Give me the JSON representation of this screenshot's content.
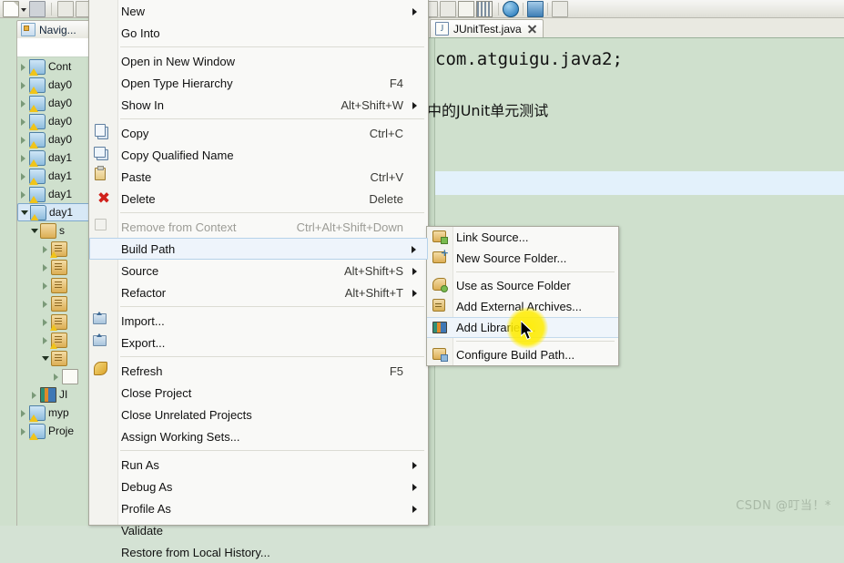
{
  "toolbar": {
    "icons": [
      "new-document-icon",
      "new-dropdown-arrow",
      "save-icon",
      "print-icon",
      "open-resource-icon",
      "search-icon",
      "new-folder-icon",
      "open-folder-icon",
      "pencil-edit-icon",
      "edit-dropdown-arrow",
      "run-icon",
      "debug-icon",
      "coverage-icon",
      "external-tools-icon",
      "table-view-icon",
      "bars-view-icon",
      "globe-browser-icon",
      "perspective-switch-icon",
      "annotation-icon"
    ]
  },
  "left_pane": {
    "tab_label": "Navig...",
    "tab_icon": "navigator-icon",
    "tree": [
      {
        "label": "Cont",
        "expanded": false,
        "icon": "project-warning-icon",
        "indent": 0,
        "selected": false
      },
      {
        "label": "day0",
        "expanded": false,
        "icon": "project-warning-icon",
        "indent": 0,
        "selected": false
      },
      {
        "label": "day0",
        "expanded": false,
        "icon": "project-warning-icon",
        "indent": 0,
        "selected": false
      },
      {
        "label": "day0",
        "expanded": false,
        "icon": "project-icon",
        "indent": 0,
        "selected": false
      },
      {
        "label": "day0",
        "expanded": false,
        "icon": "project-icon",
        "indent": 0,
        "selected": false
      },
      {
        "label": "day1",
        "expanded": false,
        "icon": "project-warning-icon",
        "indent": 0,
        "selected": false
      },
      {
        "label": "day1",
        "expanded": false,
        "icon": "project-warning-icon",
        "indent": 0,
        "selected": false
      },
      {
        "label": "day1",
        "expanded": false,
        "icon": "project-warning-icon",
        "indent": 0,
        "selected": false
      },
      {
        "label": "day1",
        "expanded": true,
        "icon": "project-warning-icon",
        "indent": 0,
        "selected": true
      },
      {
        "label": "s",
        "expanded": true,
        "icon": "source-folder-icon",
        "indent": 1,
        "selected": false
      },
      {
        "label": "",
        "expanded": false,
        "icon": "package-warning-icon",
        "indent": 2,
        "selected": false
      },
      {
        "label": "",
        "expanded": false,
        "icon": "package-icon",
        "indent": 2,
        "selected": false
      },
      {
        "label": "",
        "expanded": false,
        "icon": "package-icon",
        "indent": 2,
        "selected": false
      },
      {
        "label": "",
        "expanded": false,
        "icon": "package-icon",
        "indent": 2,
        "selected": false
      },
      {
        "label": "",
        "expanded": false,
        "icon": "package-warning-icon",
        "indent": 2,
        "selected": false
      },
      {
        "label": "",
        "expanded": false,
        "icon": "package-warning-icon",
        "indent": 2,
        "selected": false
      },
      {
        "label": "",
        "expanded": true,
        "icon": "package-icon",
        "indent": 2,
        "selected": false
      },
      {
        "label": "",
        "expanded": false,
        "icon": "file-icon",
        "indent": 3,
        "selected": false
      },
      {
        "label": "JI",
        "expanded": false,
        "icon": "jre-library-icon",
        "indent": 1,
        "selected": false
      },
      {
        "label": "myp",
        "expanded": false,
        "icon": "project-icon",
        "indent": 0,
        "selected": false
      },
      {
        "label": "Proje",
        "expanded": false,
        "icon": "project-warning-icon",
        "indent": 0,
        "selected": false
      }
    ]
  },
  "editor": {
    "tab_label": "JUnitTest.java",
    "tab_icon": "java-file-icon",
    "tab_close_icon": "close-icon",
    "code_package": "com.atguigu.java2;",
    "code_comment": "中的JUnit单元测试"
  },
  "context_menu": {
    "items": [
      {
        "label": "New",
        "accel": "",
        "submenu": true,
        "icon": "",
        "disabled": false,
        "highlight": false
      },
      {
        "label": "Go Into",
        "accel": "",
        "submenu": false,
        "icon": "",
        "disabled": false,
        "highlight": false
      },
      {
        "type": "separator"
      },
      {
        "label": "Open in New Window",
        "accel": "",
        "submenu": false,
        "icon": "",
        "disabled": false,
        "highlight": false
      },
      {
        "label": "Open Type Hierarchy",
        "accel": "F4",
        "submenu": false,
        "icon": "",
        "disabled": false,
        "highlight": false
      },
      {
        "label": "Show In",
        "accel": "Alt+Shift+W",
        "submenu": true,
        "icon": "",
        "disabled": false,
        "highlight": false
      },
      {
        "type": "separator"
      },
      {
        "label": "Copy",
        "accel": "Ctrl+C",
        "submenu": false,
        "icon": "copy-icon",
        "disabled": false,
        "highlight": false
      },
      {
        "label": "Copy Qualified Name",
        "accel": "",
        "submenu": false,
        "icon": "copy-qualified-name-icon",
        "disabled": false,
        "highlight": false
      },
      {
        "label": "Paste",
        "accel": "Ctrl+V",
        "submenu": false,
        "icon": "paste-icon",
        "disabled": false,
        "highlight": false
      },
      {
        "label": "Delete",
        "accel": "Delete",
        "submenu": false,
        "icon": "delete-icon",
        "disabled": false,
        "highlight": false
      },
      {
        "type": "separator"
      },
      {
        "label": "Remove from Context",
        "accel": "Ctrl+Alt+Shift+Down",
        "submenu": false,
        "icon": "remove-from-context-icon",
        "disabled": true,
        "highlight": false
      },
      {
        "label": "Build Path",
        "accel": "",
        "submenu": true,
        "icon": "",
        "disabled": false,
        "highlight": true
      },
      {
        "label": "Source",
        "accel": "Alt+Shift+S",
        "submenu": true,
        "icon": "",
        "disabled": false,
        "highlight": false
      },
      {
        "label": "Refactor",
        "accel": "Alt+Shift+T",
        "submenu": true,
        "icon": "",
        "disabled": false,
        "highlight": false
      },
      {
        "type": "separator"
      },
      {
        "label": "Import...",
        "accel": "",
        "submenu": false,
        "icon": "import-icon",
        "disabled": false,
        "highlight": false
      },
      {
        "label": "Export...",
        "accel": "",
        "submenu": false,
        "icon": "export-icon",
        "disabled": false,
        "highlight": false
      },
      {
        "type": "separator"
      },
      {
        "label": "Refresh",
        "accel": "F5",
        "submenu": false,
        "icon": "refresh-icon",
        "disabled": false,
        "highlight": false
      },
      {
        "label": "Close Project",
        "accel": "",
        "submenu": false,
        "icon": "",
        "disabled": false,
        "highlight": false
      },
      {
        "label": "Close Unrelated Projects",
        "accel": "",
        "submenu": false,
        "icon": "",
        "disabled": false,
        "highlight": false
      },
      {
        "label": "Assign Working Sets...",
        "accel": "",
        "submenu": false,
        "icon": "",
        "disabled": false,
        "highlight": false
      },
      {
        "type": "separator"
      },
      {
        "label": "Run As",
        "accel": "",
        "submenu": true,
        "icon": "",
        "disabled": false,
        "highlight": false
      },
      {
        "label": "Debug As",
        "accel": "",
        "submenu": true,
        "icon": "",
        "disabled": false,
        "highlight": false
      },
      {
        "label": "Profile As",
        "accel": "",
        "submenu": true,
        "icon": "",
        "disabled": false,
        "highlight": false
      },
      {
        "label": "Validate",
        "accel": "",
        "submenu": false,
        "icon": "",
        "disabled": false,
        "highlight": false
      },
      {
        "label": "Restore from Local History...",
        "accel": "",
        "submenu": false,
        "icon": "",
        "disabled": false,
        "highlight": false
      }
    ]
  },
  "submenu": {
    "items": [
      {
        "label": "Link Source...",
        "icon": "link-source-icon",
        "highlight": false
      },
      {
        "label": "New Source Folder...",
        "icon": "new-source-folder-icon",
        "highlight": false
      },
      {
        "type": "separator"
      },
      {
        "label": "Use as Source Folder",
        "icon": "use-as-source-folder-icon",
        "highlight": false
      },
      {
        "label": "Add External Archives...",
        "icon": "add-external-archives-icon",
        "highlight": false
      },
      {
        "label": "Add Libraries...",
        "icon": "add-libraries-icon",
        "highlight": true
      },
      {
        "type": "separator"
      },
      {
        "label": "Configure Build Path...",
        "icon": "configure-build-path-icon",
        "highlight": false
      }
    ]
  },
  "watermark": "CSDN @叮当！*",
  "colors": {
    "editor_background": "#cfe0cd",
    "current_line": "#e3f1fb",
    "menu_background": "#f9f9f7",
    "highlight_border": "#b6d2ea",
    "cursor_halo": "#ffec00"
  }
}
